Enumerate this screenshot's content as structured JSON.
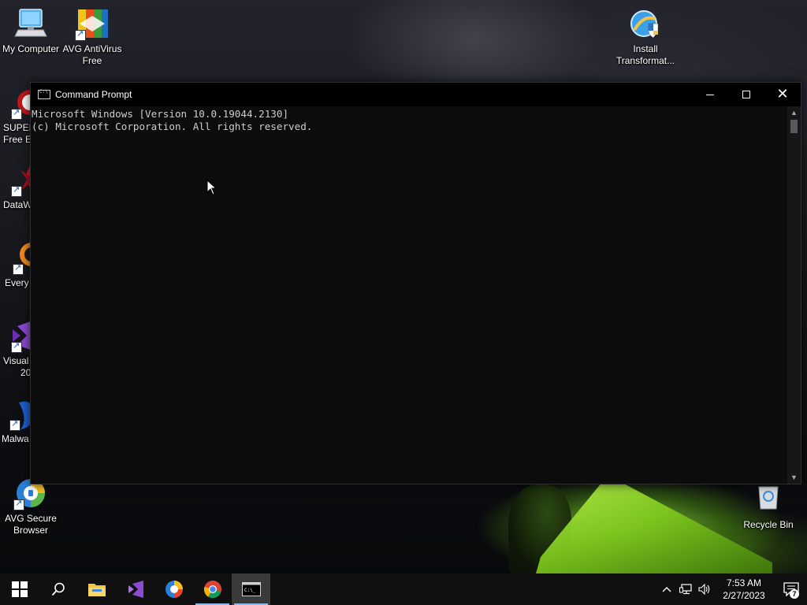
{
  "desktop": {
    "icons": [
      {
        "label": "My Computer",
        "icon": "monitor-icon"
      },
      {
        "label": "AVG AntiVirus Free",
        "icon": "avg-antivirus-icon"
      },
      {
        "label": "Install Transformat...",
        "icon": "installer-icon"
      },
      {
        "label": "SUPER",
        "label2": "Free E",
        "icon": "super-icon"
      },
      {
        "label": "DataW",
        "icon": "datawrapper-icon"
      },
      {
        "label": "Every",
        "icon": "everything-search-icon"
      },
      {
        "label": "Visual",
        "label2": "20",
        "icon": "visual-studio-icon"
      },
      {
        "label": "Malwa",
        "icon": "malwarebytes-icon"
      },
      {
        "label": "AVG Secure Browser",
        "icon": "avg-browser-icon"
      },
      {
        "label": "Recycle Bin",
        "icon": "recycle-bin-icon"
      }
    ]
  },
  "window": {
    "title": "Command Prompt",
    "lines": [
      "Microsoft Windows [Version 10.0.19044.2130]",
      "(c) Microsoft Corporation. All rights reserved."
    ]
  },
  "taskbar": {
    "apps": [
      {
        "name": "start",
        "icon": "windows-start-icon"
      },
      {
        "name": "search",
        "icon": "search-icon"
      },
      {
        "name": "file-explorer",
        "icon": "folder-icon"
      },
      {
        "name": "visual-studio",
        "icon": "visual-studio-icon"
      },
      {
        "name": "avg-secure-browser",
        "icon": "avg-browser-icon"
      },
      {
        "name": "chrome",
        "icon": "chrome-icon"
      },
      {
        "name": "command-prompt",
        "icon": "cmd-icon"
      }
    ],
    "time": "7:53 AM",
    "date": "2/27/2023",
    "notification_count": "7"
  },
  "colors": {
    "console_bg": "#0c0c0c",
    "console_text": "#cccccc",
    "taskbar_bg": "#101010",
    "wallpaper_green": "#8fd62a"
  }
}
